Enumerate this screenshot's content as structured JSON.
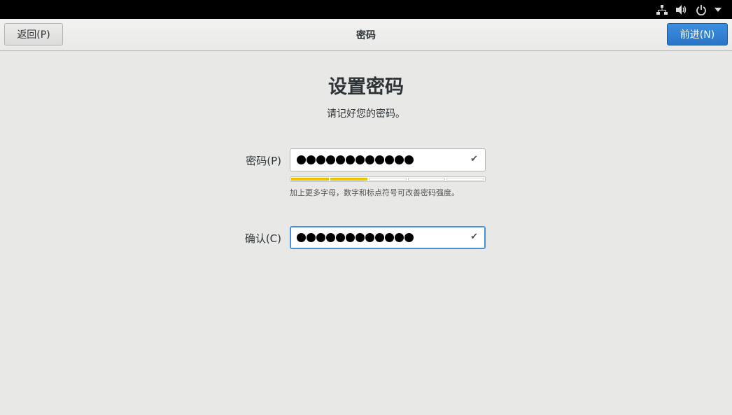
{
  "header": {
    "back_label": "返回(P)",
    "title": "密码",
    "next_label": "前进(N)"
  },
  "system_icons": [
    "network-icon",
    "volume-icon",
    "power-icon",
    "chevron-down-icon"
  ],
  "main": {
    "title": "设置密码",
    "subtitle": "请记好您的密码。",
    "password": {
      "label": "密码(P)",
      "masked_length": 12,
      "strength_segments_filled": 2,
      "strength_segments_total": 5,
      "hint": "加上更多字母，数字和标点符号可改善密码强度。"
    },
    "confirm": {
      "label": "确认(C)",
      "masked_length": 12
    }
  },
  "colors": {
    "accent": "#2a76c6",
    "strength": "#f0c800",
    "background": "#e8e8e7"
  }
}
